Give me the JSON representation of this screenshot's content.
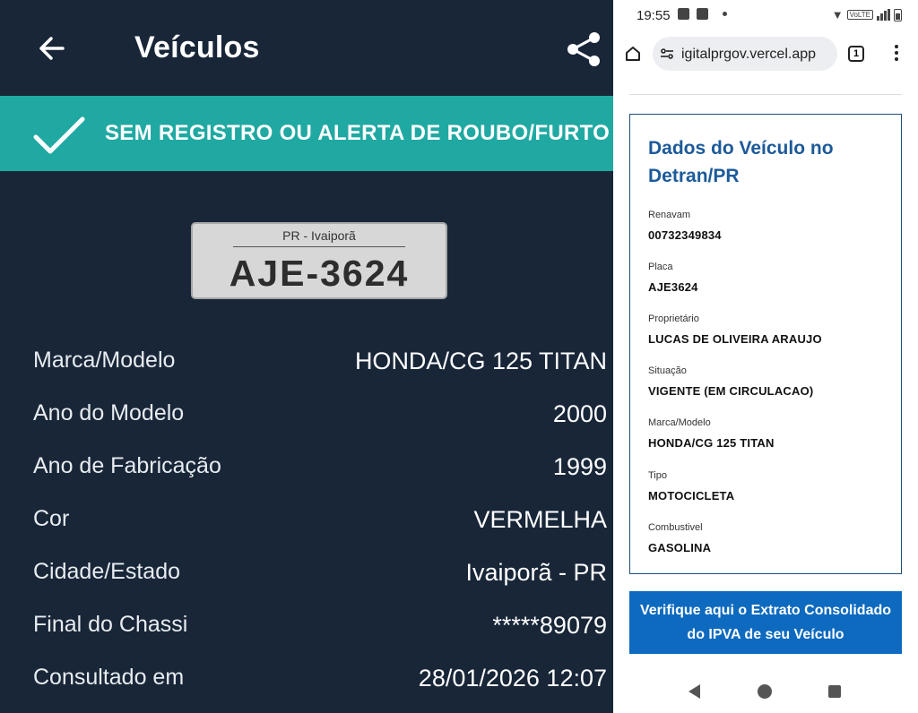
{
  "left": {
    "title": "Veículos",
    "banner_text": "SEM REGISTRO OU ALERTA DE ROUBO/FURTO",
    "plate": {
      "region": "PR - Ivaiporã",
      "number": "AJE-3624"
    },
    "rows": [
      {
        "label": "Marca/Modelo",
        "value": "HONDA/CG 125 TITAN"
      },
      {
        "label": "Ano do Modelo",
        "value": "2000"
      },
      {
        "label": "Ano de Fabricação",
        "value": "1999"
      },
      {
        "label": "Cor",
        "value": "VERMELHA"
      },
      {
        "label": "Cidade/Estado",
        "value": "Ivaiporã - PR"
      },
      {
        "label": "Final do Chassi",
        "value": "*****89079"
      },
      {
        "label": "Consultado em",
        "value": "28/01/2026 12:07"
      }
    ],
    "colors": {
      "background": "#182638",
      "banner": "#20a9a2"
    },
    "icons": {
      "back": "arrow-left-icon",
      "share": "share-icon",
      "check": "check-icon"
    }
  },
  "right": {
    "status": {
      "time": "19:55",
      "volte": "VoLTE"
    },
    "browser": {
      "url": "igitalprgov.vercel.app",
      "tabs_count": "1"
    },
    "card": {
      "title": "Dados do Veículo no Detran/PR",
      "fields": [
        {
          "label": "Renavam",
          "value": "00732349834"
        },
        {
          "label": "Placa",
          "value": "AJE3624"
        },
        {
          "label": "Proprietário",
          "value": "LUCAS DE OLIVEIRA ARAUJO"
        },
        {
          "label": "Situação",
          "value": "VIGENTE (EM CIRCULACAO)"
        },
        {
          "label": "Marca/Modelo",
          "value": "HONDA/CG 125 TITAN"
        },
        {
          "label": "Tipo",
          "value": "MOTOCICLETA"
        },
        {
          "label": "Combustivel",
          "value": "GASOLINA"
        }
      ]
    },
    "cta_label": "Verifique aqui o Extrato Consolidado do IPVA de seu Veículo",
    "colors": {
      "title": "#1c5a9a",
      "cta": "#0d6abf"
    }
  }
}
